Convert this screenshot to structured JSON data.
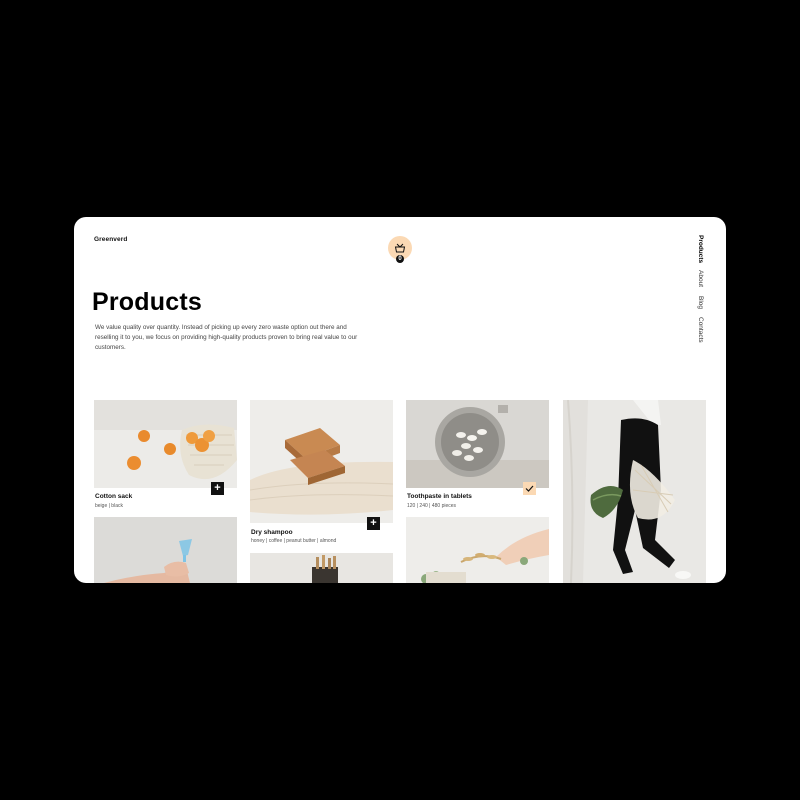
{
  "brand": {
    "name": "Greenverd"
  },
  "cart": {
    "badge": "0",
    "icon": "shopping-basket-icon",
    "accent": "#fbd9b4"
  },
  "nav": {
    "items": [
      {
        "label": "Products",
        "active": true
      },
      {
        "label": "About",
        "active": false
      },
      {
        "label": "Blog",
        "active": false
      },
      {
        "label": "Contacts",
        "active": false
      }
    ]
  },
  "page": {
    "title": "Products",
    "description": "We value quality over quantity. Instead of picking up every zero waste option out there and reselling it to you, we focus on providing high-quality products proven to bring real value to our customers."
  },
  "products": [
    {
      "name": "Cotton sack",
      "meta": "beige | black",
      "action": "+",
      "in_cart": false,
      "image": "oranges-in-mesh-bag"
    },
    {
      "name": "Dry shampoo",
      "meta": "honey | coffee | peanut butter | almond",
      "action": "+",
      "in_cart": false,
      "image": "soap-bars-on-cloth"
    },
    {
      "name": "Toothpaste in tablets",
      "meta": "120 | 240 | 480 pieces",
      "action": "check",
      "in_cart": true,
      "image": "tablets-in-jar"
    },
    {
      "name": "",
      "meta": "",
      "image": "woman-with-mesh-bag"
    },
    {
      "name": "",
      "meta": "",
      "image": "hand-holding-menstrual-cup"
    },
    {
      "name": "",
      "meta": "",
      "image": "bamboo-toothbrushes"
    },
    {
      "name": "",
      "meta": "",
      "image": "hand-arranging-dried-plants"
    }
  ]
}
